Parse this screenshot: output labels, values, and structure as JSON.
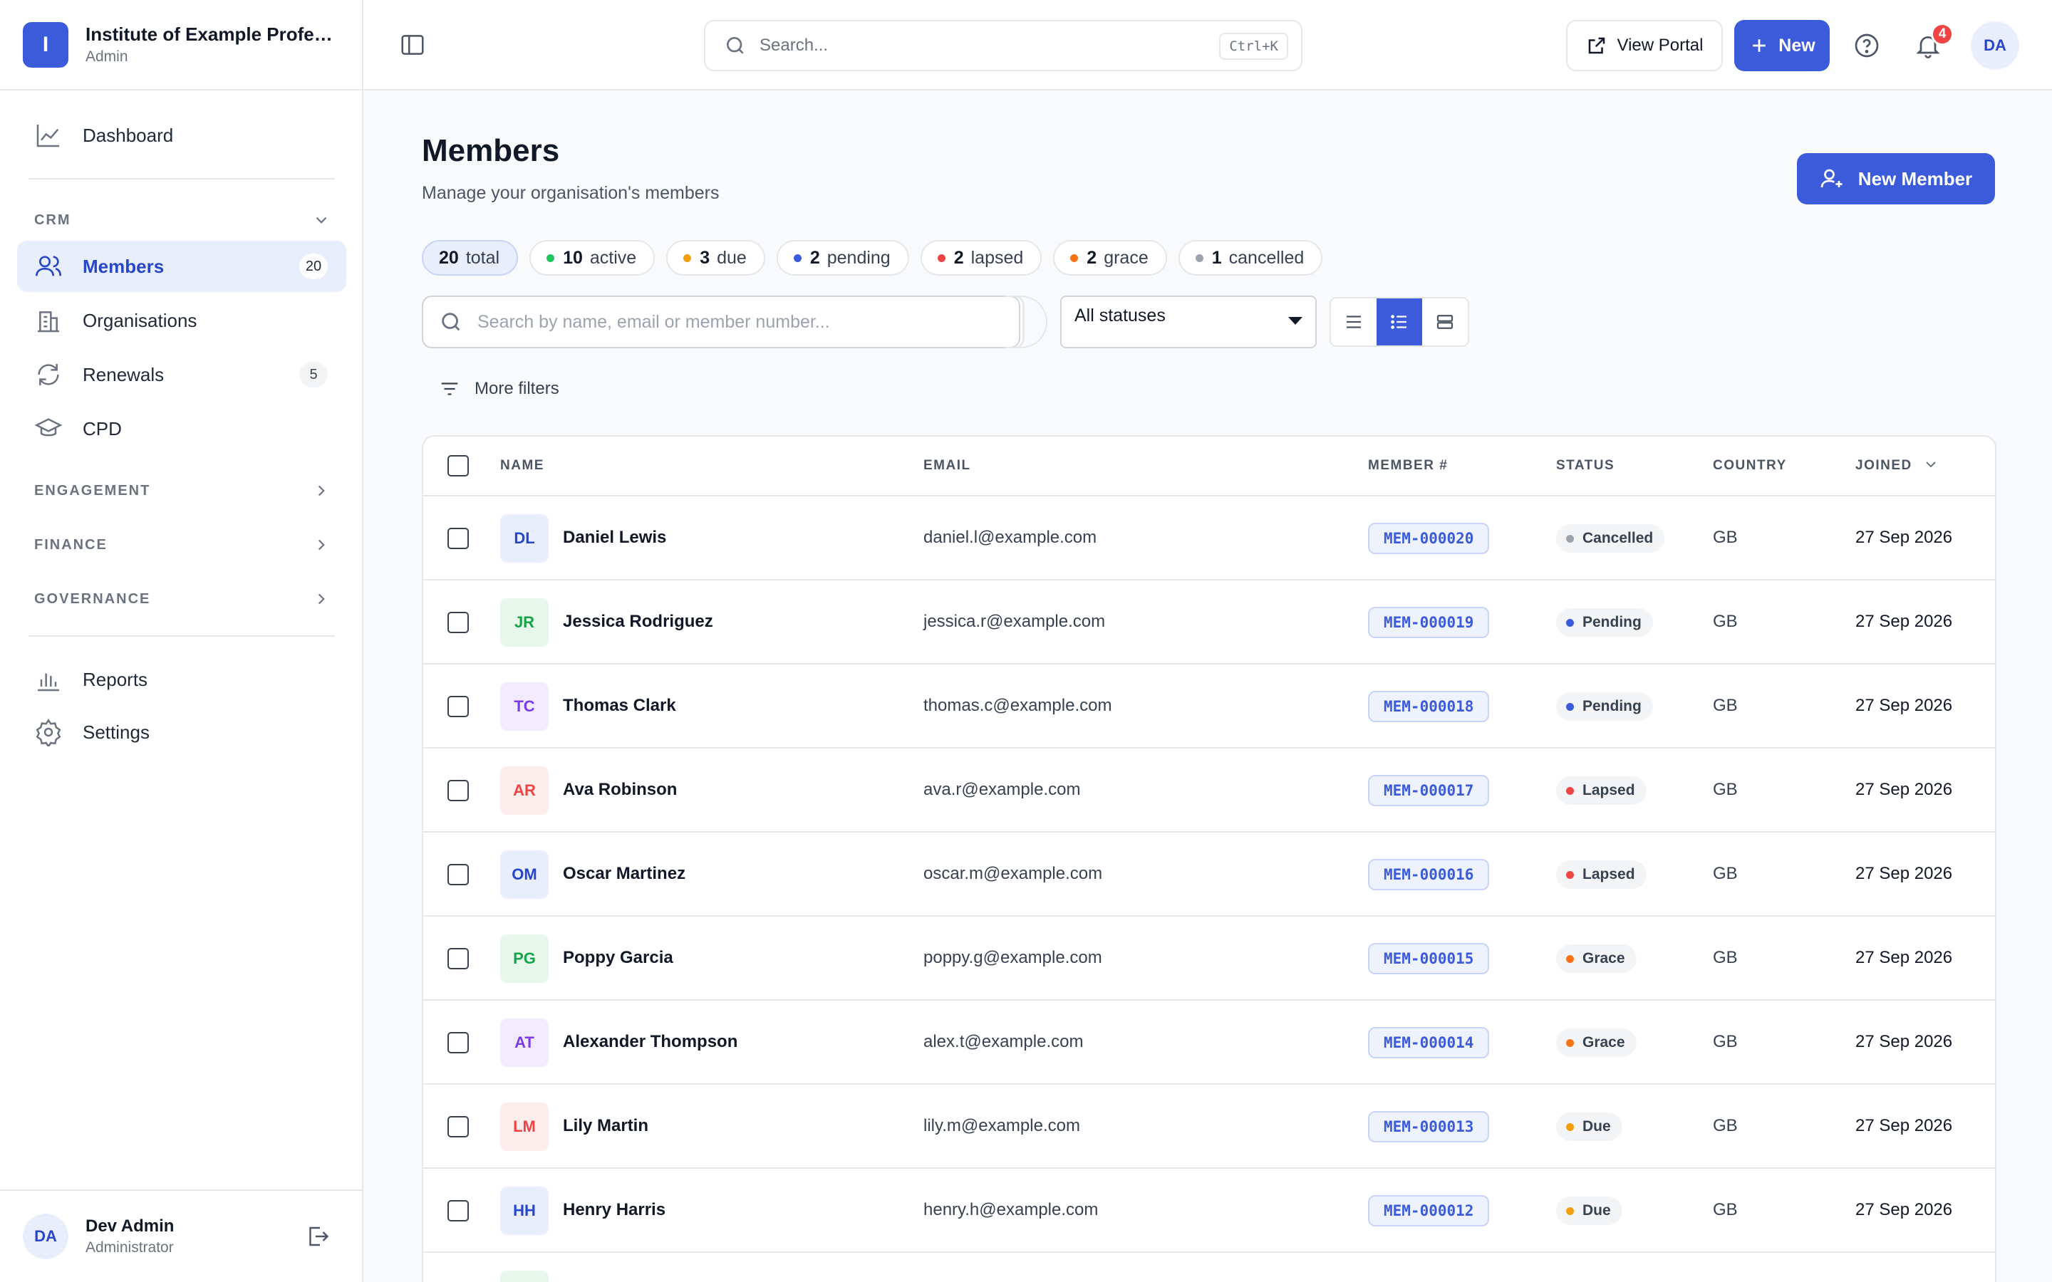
{
  "org": {
    "initial": "I",
    "name": "Institute of Example Professionals",
    "role": "Admin"
  },
  "nav": {
    "dashboard": "Dashboard",
    "crm_section": "CRM",
    "members": "Members",
    "members_count": "20",
    "organisations": "Organisations",
    "renewals": "Renewals",
    "renewals_count": "5",
    "cpd": "CPD",
    "engagement": "ENGAGEMENT",
    "finance": "FINANCE",
    "governance": "GOVERNANCE",
    "reports": "Reports",
    "settings": "Settings"
  },
  "user": {
    "initials": "DA",
    "name": "Dev Admin",
    "role": "Administrator"
  },
  "topbar": {
    "search_placeholder": "Search...",
    "shortcut": "Ctrl+K",
    "view_portal": "View Portal",
    "new": "New",
    "notifications": "4",
    "avatar": "DA"
  },
  "page": {
    "title": "Members",
    "subtitle": "Manage your organisation's members",
    "new_member": "New Member"
  },
  "summary": [
    {
      "count": "20",
      "label": "total",
      "color": ""
    },
    {
      "count": "10",
      "label": "active",
      "color": "#22c55e"
    },
    {
      "count": "3",
      "label": "due",
      "color": "#f59e0b"
    },
    {
      "count": "2",
      "label": "pending",
      "color": "#3b5bdb"
    },
    {
      "count": "2",
      "label": "lapsed",
      "color": "#ef4444"
    },
    {
      "count": "2",
      "label": "grace",
      "color": "#f97316"
    },
    {
      "count": "1",
      "label": "cancelled",
      "color": "#9ca3af"
    }
  ],
  "filters": {
    "search_placeholder": "Search by name, email or member number...",
    "status_selected": "All statuses",
    "more_filters": "More filters"
  },
  "table": {
    "columns": {
      "name": "NAME",
      "email": "EMAIL",
      "member_no": "MEMBER #",
      "status": "STATUS",
      "country": "COUNTRY",
      "joined": "JOINED"
    },
    "rows": [
      {
        "initials": "DL",
        "name": "Daniel Lewis",
        "email": "daniel.l@example.com",
        "number": "MEM-000020",
        "status": "Cancelled",
        "status_color": "#9ca3af",
        "avatar_bg": "#e8eefc",
        "avatar_fg": "#2746c9",
        "country": "GB",
        "joined": "27 Sep 2026"
      },
      {
        "initials": "JR",
        "name": "Jessica Rodriguez",
        "email": "jessica.r@example.com",
        "number": "MEM-000019",
        "status": "Pending",
        "status_color": "#3b5bdb",
        "avatar_bg": "#e7f7ec",
        "avatar_fg": "#16a34a",
        "country": "GB",
        "joined": "27 Sep 2026"
      },
      {
        "initials": "TC",
        "name": "Thomas Clark",
        "email": "thomas.c@example.com",
        "number": "MEM-000018",
        "status": "Pending",
        "status_color": "#3b5bdb",
        "avatar_bg": "#f1ebfd",
        "avatar_fg": "#7c3aed",
        "country": "GB",
        "joined": "27 Sep 2026"
      },
      {
        "initials": "AR",
        "name": "Ava Robinson",
        "email": "ava.r@example.com",
        "number": "MEM-000017",
        "status": "Lapsed",
        "status_color": "#ef4444",
        "avatar_bg": "#fdecec",
        "avatar_fg": "#ef4444",
        "country": "GB",
        "joined": "27 Sep 2026"
      },
      {
        "initials": "OM",
        "name": "Oscar Martinez",
        "email": "oscar.m@example.com",
        "number": "MEM-000016",
        "status": "Lapsed",
        "status_color": "#ef4444",
        "avatar_bg": "#e8eefc",
        "avatar_fg": "#2746c9",
        "country": "GB",
        "joined": "27 Sep 2026"
      },
      {
        "initials": "PG",
        "name": "Poppy Garcia",
        "email": "poppy.g@example.com",
        "number": "MEM-000015",
        "status": "Grace",
        "status_color": "#f97316",
        "avatar_bg": "#e7f7ec",
        "avatar_fg": "#16a34a",
        "country": "GB",
        "joined": "27 Sep 2026"
      },
      {
        "initials": "AT",
        "name": "Alexander Thompson",
        "email": "alex.t@example.com",
        "number": "MEM-000014",
        "status": "Grace",
        "status_color": "#f97316",
        "avatar_bg": "#f1ebfd",
        "avatar_fg": "#7c3aed",
        "country": "GB",
        "joined": "27 Sep 2026"
      },
      {
        "initials": "LM",
        "name": "Lily Martin",
        "email": "lily.m@example.com",
        "number": "MEM-000013",
        "status": "Due",
        "status_color": "#f59e0b",
        "avatar_bg": "#fdecec",
        "avatar_fg": "#ef4444",
        "country": "GB",
        "joined": "27 Sep 2026"
      },
      {
        "initials": "HH",
        "name": "Henry Harris",
        "email": "henry.h@example.com",
        "number": "MEM-000012",
        "status": "Due",
        "status_color": "#f59e0b",
        "avatar_bg": "#e8eefc",
        "avatar_fg": "#2746c9",
        "country": "GB",
        "joined": "27 Sep 2026"
      },
      {
        "initials": "",
        "name": "",
        "email": "",
        "number": "",
        "status": "",
        "status_color": "#22c55e",
        "avatar_bg": "#e7f7ec",
        "avatar_fg": "#16a34a",
        "country": "",
        "joined": ""
      }
    ]
  }
}
